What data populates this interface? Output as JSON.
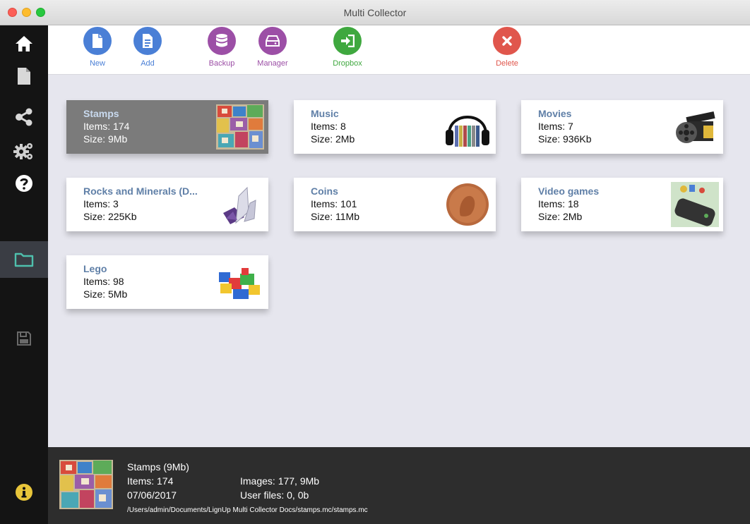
{
  "window": {
    "title": "Multi Collector"
  },
  "sidebar": {
    "items": [
      {
        "icon": "home-icon"
      },
      {
        "icon": "file-icon"
      },
      {
        "icon": "share-icon"
      },
      {
        "icon": "gears-icon"
      },
      {
        "icon": "help-icon"
      },
      {
        "icon": "folder-icon",
        "active": true
      },
      {
        "icon": "save-icon"
      },
      {
        "icon": "info-icon"
      }
    ]
  },
  "toolbar": {
    "new_label": "New",
    "add_label": "Add",
    "backup_label": "Backup",
    "manager_label": "Manager",
    "dropbox_label": "Dropbox",
    "delete_label": "Delete"
  },
  "colors": {
    "blue": "#4a7fd6",
    "purple": "#9c4fa6",
    "green": "#3fa83f",
    "red": "#e0564c",
    "link": "#5f7fa7"
  },
  "collections": [
    {
      "name": "Stamps",
      "items": "Items: 174",
      "size": "Size: 9Mb",
      "selected": true
    },
    {
      "name": "Music",
      "items": "Items: 8",
      "size": "Size: 2Mb"
    },
    {
      "name": "Movies",
      "items": "Items: 7",
      "size": "Size: 936Kb"
    },
    {
      "name": "Rocks and Minerals (D...",
      "items": "Items: 3",
      "size": "Size: 225Kb"
    },
    {
      "name": "Coins",
      "items": "Items: 101",
      "size": "Size: 11Mb"
    },
    {
      "name": "Video games",
      "items": "Items: 18",
      "size": "Size: 2Mb"
    },
    {
      "name": "Lego",
      "items": "Items: 98",
      "size": "Size: 5Mb"
    }
  ],
  "status": {
    "title": "Stamps (9Mb)",
    "items": "Items: 174",
    "date": "07/06/2017",
    "images": "Images: 177,  9Mb",
    "user_files": "User files: 0,  0b",
    "path": "/Users/admin/Documents/LignUp Multi Collector Docs/stamps.mc/stamps.mc"
  }
}
